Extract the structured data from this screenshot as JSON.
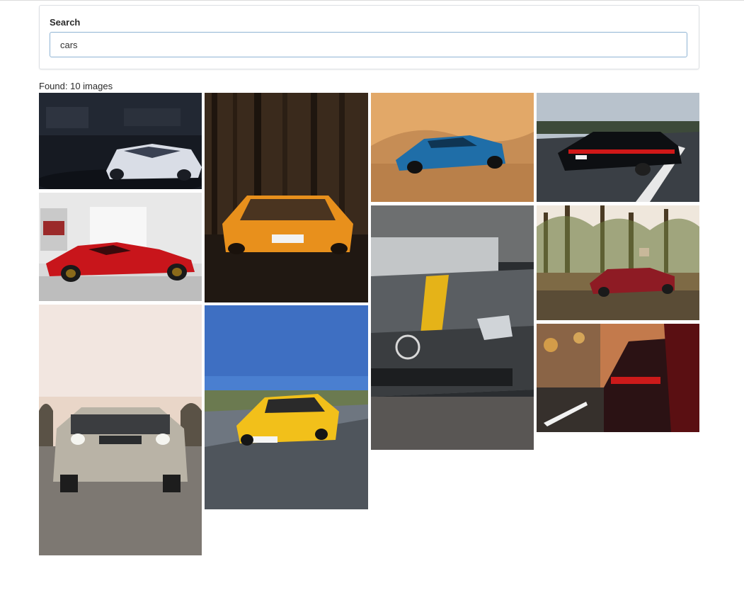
{
  "search": {
    "label": "Search",
    "value": "cars"
  },
  "results": {
    "found_text": "Found: 10 images"
  },
  "images": [
    {
      "name": "white-camaro-garage",
      "colors": [
        "#161a22",
        "#2b3240",
        "#d9dde6"
      ]
    },
    {
      "name": "orange-lamborghini-forest",
      "colors": [
        "#3a2a1c",
        "#201812",
        "#e8901c"
      ]
    },
    {
      "name": "blue-camaro-desert",
      "colors": [
        "#d79a52",
        "#b9804a",
        "#1f6ea8"
      ]
    },
    {
      "name": "black-porsche-road",
      "colors": [
        "#b8c2cc",
        "#3a3f45",
        "#0d0f12"
      ]
    },
    {
      "name": "red-ferrari-showroom",
      "colors": [
        "#d9d9d9",
        "#f2f2f2",
        "#c8151b"
      ]
    },
    {
      "name": "yellow-stripe-mercedes",
      "colors": [
        "#2a2d30",
        "#5a5e62",
        "#e5b318"
      ]
    },
    {
      "name": "red-amg-field",
      "colors": [
        "#d9c9a8",
        "#7e6a45",
        "#8e1b24"
      ]
    },
    {
      "name": "silver-challenger-road",
      "colors": [
        "#f2e6e0",
        "#7d7872",
        "#b9b3a6"
      ]
    },
    {
      "name": "yellow-amg-gt",
      "colors": [
        "#4a7fd0",
        "#6e7680",
        "#f2c01a"
      ]
    },
    {
      "name": "red-audi-street",
      "colors": [
        "#c37a4c",
        "#36302c",
        "#cc1a1a"
      ]
    }
  ]
}
